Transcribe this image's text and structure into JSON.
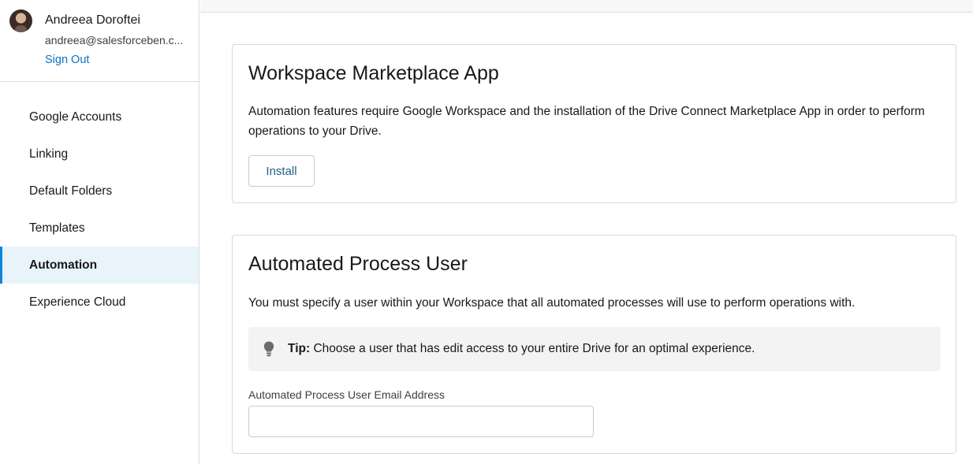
{
  "user": {
    "name": "Andreea Doroftei",
    "email": "andreea@salesforceben.c...",
    "sign_out_label": "Sign Out"
  },
  "sidebar": {
    "items": [
      {
        "label": "Google Accounts",
        "active": false
      },
      {
        "label": "Linking",
        "active": false
      },
      {
        "label": "Default Folders",
        "active": false
      },
      {
        "label": "Templates",
        "active": false
      },
      {
        "label": "Automation",
        "active": true
      },
      {
        "label": "Experience Cloud",
        "active": false
      }
    ],
    "active_color": "#0b85d9"
  },
  "marketplace": {
    "title": "Workspace Marketplace App",
    "description": "Automation features require Google Workspace and the installation of the Drive Connect Marketplace App in order to perform operations to your Drive.",
    "install_label": "Install"
  },
  "process_user": {
    "title": "Automated Process User",
    "description": "You must specify a user within your Workspace that all automated processes will use to perform operations with.",
    "tip": {
      "icon": "lightbulb-icon",
      "label": "Tip:",
      "text": "Choose a user that has edit access to your entire Drive for an optimal experience."
    },
    "email_label": "Automated Process User Email Address",
    "email_value": "",
    "email_placeholder": ""
  }
}
